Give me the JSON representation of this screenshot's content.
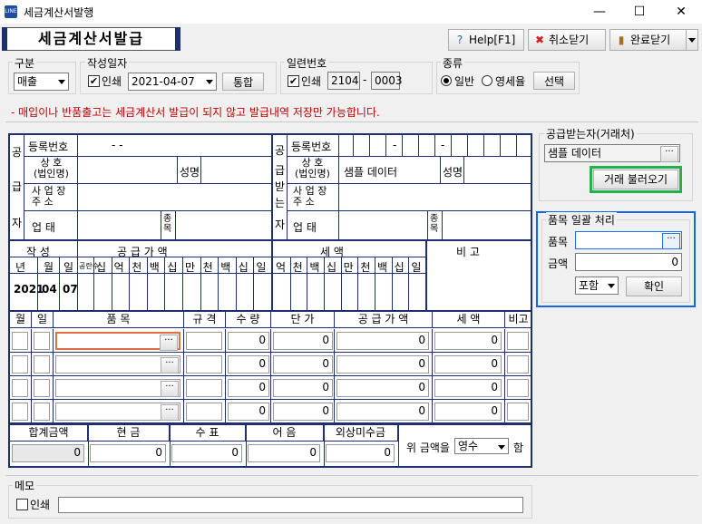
{
  "window": {
    "title": "세금계산서발행",
    "minimize": "—",
    "maximize": "☐",
    "close": "✕",
    "icon_text": "LINE"
  },
  "header": {
    "title": "세금계산서발급"
  },
  "toolbar": {
    "help": "Help[F1]",
    "cancel": "취소닫기",
    "done": "완료닫기"
  },
  "top": {
    "gubun_label": "구분",
    "gubun_value": "매출",
    "date_label": "작성일자",
    "print": "인쇄",
    "date_value": "2021-04-07",
    "merge": "통합",
    "serial_label": "일련번호",
    "serial_a": "2104",
    "serial_dash": "-",
    "serial_b": "0003",
    "type_label": "종류",
    "type_normal": "일반",
    "type_zero": "영세율",
    "select_btn": "선택"
  },
  "notice": "- 매입이나 반품출고는 세금계산서 발급이 되지 않고 발급내역 저장만 가능합니다.",
  "supplier": {
    "side": [
      "공",
      "급",
      "자"
    ],
    "reg": "등록번호",
    "reg_value": "-  -",
    "name": [
      "상    호",
      "(법인명)"
    ],
    "ceo": "성명",
    "addr": [
      "사 업 장",
      "주    소"
    ],
    "biz": "업    태",
    "item": [
      "종",
      "목"
    ]
  },
  "buyer": {
    "side": [
      "공",
      "급",
      "받",
      "는",
      "자"
    ],
    "reg": "등록번호",
    "dash1": "-",
    "dash2": "-",
    "name": [
      "상    호",
      "(법인명)"
    ],
    "name_value": "샘플 데이터",
    "ceo": "성명",
    "addr": [
      "사 업 장",
      "주    소"
    ],
    "biz": "업    태",
    "item": [
      "종",
      "목"
    ]
  },
  "amounts": {
    "written": "작    성",
    "supply": "공    급    가    액",
    "tax": "세        액",
    "note": "비    고",
    "ymd": [
      "년",
      "월",
      "일"
    ],
    "blank": "공란수",
    "supply_digits": [
      "십",
      "억",
      "천",
      "백",
      "십",
      "만",
      "천",
      "백",
      "십",
      "일"
    ],
    "tax_digits": [
      "억",
      "천",
      "백",
      "십",
      "만",
      "천",
      "백",
      "십",
      "일"
    ],
    "year": "2021",
    "month": "04",
    "day": "07"
  },
  "lines": {
    "headers": [
      "월",
      "일",
      "품          목",
      "규 격",
      "수 량",
      "단  가",
      "공 급 가 액",
      "세   액",
      "비고"
    ],
    "rows": [
      {
        "qty": "0",
        "price": "0",
        "supply": "0",
        "tax": "0"
      },
      {
        "qty": "0",
        "price": "0",
        "supply": "0",
        "tax": "0"
      },
      {
        "qty": "0",
        "price": "0",
        "supply": "0",
        "tax": "0"
      },
      {
        "qty": "0",
        "price": "0",
        "supply": "0",
        "tax": "0"
      }
    ],
    "dots": "···"
  },
  "totals": {
    "headers": [
      "합계금액",
      "현    금",
      "수    표",
      "어    음",
      "외상미수금"
    ],
    "values": [
      "0",
      "0",
      "0",
      "0",
      "0"
    ],
    "above": "위 금액을",
    "receipt": "영수",
    "receipt_suffix": "함"
  },
  "right": {
    "buyer_label": "공급받는자(거래처)",
    "buyer_value": "샘플 데이터",
    "load": "거래 불러오기",
    "batch_label": "품목 일괄 처리",
    "item": "품목",
    "amount": "금액",
    "amount_value": "0",
    "incl": "포함",
    "ok": "확인"
  },
  "memo": {
    "label": "메모",
    "print": "인쇄"
  }
}
